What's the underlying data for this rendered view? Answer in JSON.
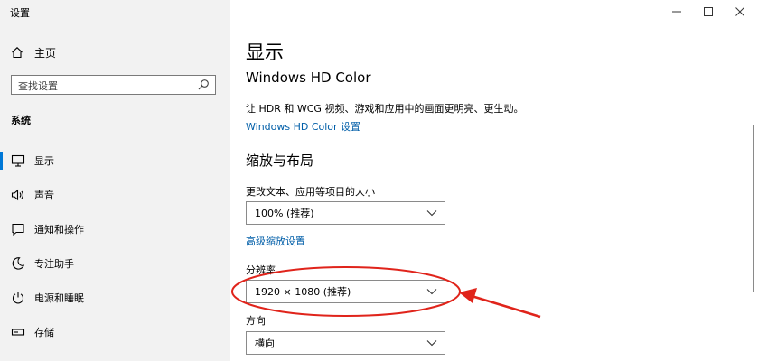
{
  "app": {
    "title": "设置"
  },
  "sidebar": {
    "home_label": "主页",
    "search": {
      "placeholder": "查找设置"
    },
    "section_label": "系统",
    "items": [
      {
        "label": "显示",
        "icon": "monitor-icon",
        "selected": true
      },
      {
        "label": "声音",
        "icon": "speaker-icon",
        "selected": false
      },
      {
        "label": "通知和操作",
        "icon": "notification-icon",
        "selected": false
      },
      {
        "label": "专注助手",
        "icon": "moon-icon",
        "selected": false
      },
      {
        "label": "电源和睡眠",
        "icon": "power-icon",
        "selected": false
      },
      {
        "label": "存储",
        "icon": "storage-icon",
        "selected": false
      }
    ]
  },
  "main": {
    "page_title": "显示",
    "hdr": {
      "heading": "Windows HD Color",
      "description": "让 HDR 和 WCG 视频、游戏和应用中的画面更明亮、更生动。",
      "settings_link": "Windows HD Color 设置"
    },
    "scale_layout": {
      "heading": "缩放与布局",
      "scale_label": "更改文本、应用等项目的大小",
      "scale_value": "100% (推荐)",
      "advanced_link": "高级缩放设置",
      "resolution_label": "分辨率",
      "resolution_value": "1920 × 1080 (推荐)",
      "orientation_label": "方向",
      "orientation_value": "横向"
    }
  },
  "colors": {
    "accent": "#0078d7",
    "link": "#005ea8",
    "sidebar_bg": "#f2f2f2",
    "annotation": "#e0241b"
  }
}
